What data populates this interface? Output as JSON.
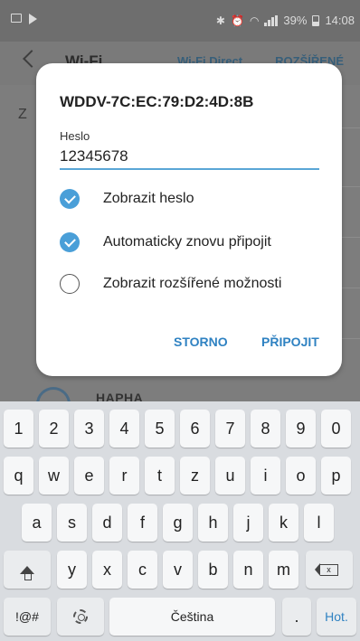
{
  "status_bar": {
    "battery": "39%",
    "time": "14:08"
  },
  "app_bar": {
    "title": "Wi-Fi",
    "wifi_direct": "Wi-Fi Direct",
    "advanced": "ROZŠÍŘENÉ"
  },
  "background_list": {
    "letter": "Z",
    "network_name": "HAPHA"
  },
  "dialog": {
    "title": "WDDV-7C:EC:79:D2:4D:8B",
    "password_label": "Heslo",
    "password_value": "12345678",
    "options": [
      {
        "label": "Zobrazit heslo",
        "checked": true
      },
      {
        "label": "Automaticky znovu připojit",
        "checked": true
      },
      {
        "label": "Zobrazit rozšířené možnosti",
        "checked": false
      }
    ],
    "cancel_label": "STORNO",
    "connect_label": "PŘIPOJIT"
  },
  "keyboard": {
    "row1": [
      "1",
      "2",
      "3",
      "4",
      "5",
      "6",
      "7",
      "8",
      "9",
      "0"
    ],
    "row2": [
      "q",
      "w",
      "e",
      "r",
      "t",
      "z",
      "u",
      "i",
      "o",
      "p"
    ],
    "row3": [
      "a",
      "s",
      "d",
      "f",
      "g",
      "h",
      "j",
      "k",
      "l"
    ],
    "row4": [
      "y",
      "x",
      "c",
      "v",
      "b",
      "n",
      "m"
    ],
    "symbols_label": "!@#",
    "space_label": "Čeština",
    "period_label": ".",
    "action_label": "Hot.",
    "backspace_mark": "x"
  },
  "colors": {
    "accent": "#2f82c2",
    "checkbox": "#4a9fd8",
    "input_underline": "#5aa6d6"
  }
}
